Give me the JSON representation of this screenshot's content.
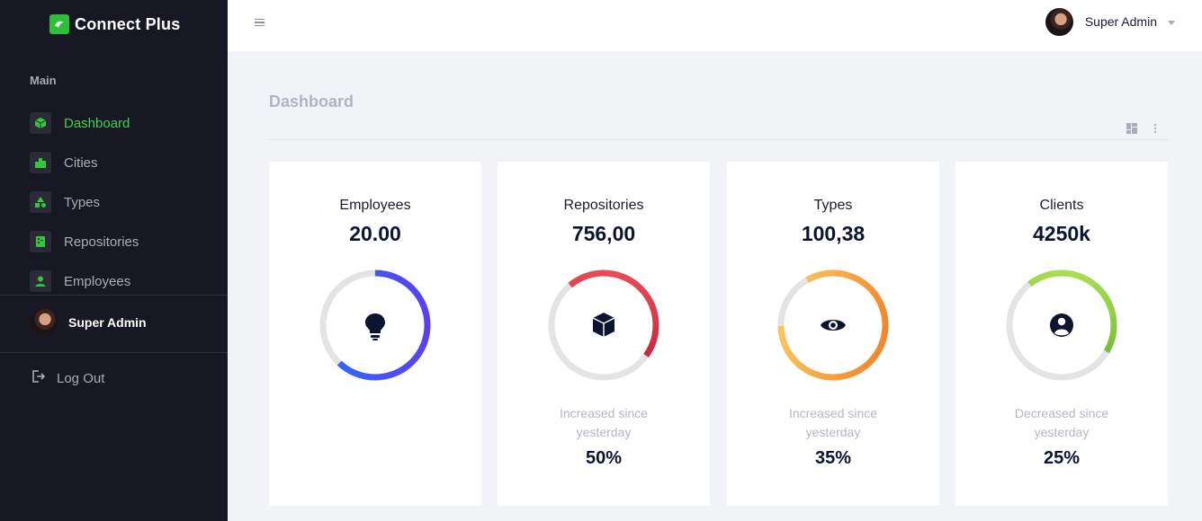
{
  "brand": {
    "name": "Connect Plus",
    "logo_icon": "leaf-icon",
    "accent": "#2dbf3a"
  },
  "sidebar": {
    "section_label": "Main",
    "items": [
      {
        "label": "Dashboard",
        "icon": "cube-icon",
        "active": true
      },
      {
        "label": "Cities",
        "icon": "city-icon",
        "active": false
      },
      {
        "label": "Types",
        "icon": "shapes-icon",
        "active": false
      },
      {
        "label": "Repositories",
        "icon": "repository-icon",
        "active": false
      },
      {
        "label": "Employees",
        "icon": "user-icon",
        "active": false
      }
    ],
    "profile": {
      "name": "Super Admin"
    },
    "logout_label": "Log Out"
  },
  "topbar": {
    "user_name": "Super Admin"
  },
  "main": {
    "title": "Dashboard",
    "cards": [
      {
        "title": "Employees",
        "value": "20.00",
        "icon": "lightbulb-icon",
        "progress": 0.62,
        "colors": [
          "#2f6bff",
          "#5b3ff0"
        ],
        "caption_line1": "",
        "caption_line2": "",
        "percent": ""
      },
      {
        "title": "Repositories",
        "value": "756,00",
        "icon": "box-icon",
        "progress": 0.46,
        "colors": [
          "#f0545f",
          "#b3162e"
        ],
        "caption_line1": "Increased since",
        "caption_line2": "yesterday",
        "percent": "50%"
      },
      {
        "title": "Types",
        "value": "100,38",
        "icon": "eye-icon",
        "progress": 0.83,
        "colors": [
          "#fbd56a",
          "#f07a22"
        ],
        "caption_line1": "Increased since",
        "caption_line2": "yesterday",
        "percent": "35%"
      },
      {
        "title": "Clients",
        "value": "4250k",
        "icon": "user-circle-icon",
        "progress": 0.44,
        "colors": [
          "#b6e55a",
          "#56a72c"
        ],
        "caption_line1": "Decreased since",
        "caption_line2": "yesterday",
        "percent": "25%"
      }
    ]
  }
}
